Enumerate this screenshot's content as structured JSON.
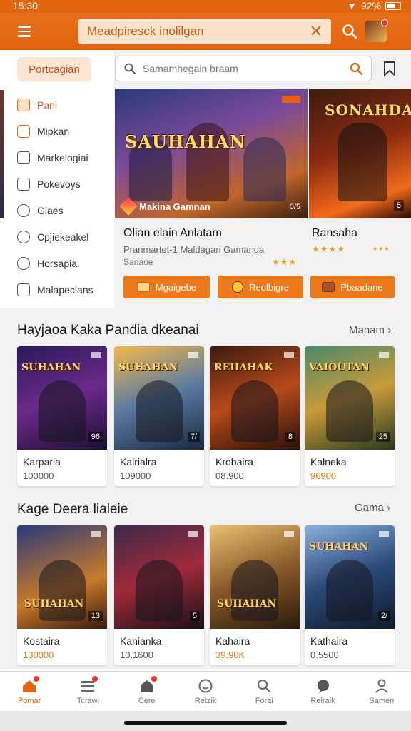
{
  "status": {
    "time": "15:30",
    "battery": "92%"
  },
  "appbar": {
    "search_text": "Meadpiresck inolilgan"
  },
  "sidebar": {
    "title": "Portcagian",
    "items": [
      {
        "label": "Pani",
        "icon": "gift-icon"
      },
      {
        "label": "Mipkan",
        "icon": "flag-icon"
      },
      {
        "label": "Markelogiai",
        "icon": "store-icon"
      },
      {
        "label": "Pokevoys",
        "icon": "card-icon"
      },
      {
        "label": "Giaes",
        "icon": "tag-icon"
      },
      {
        "label": "Cpjiekeakel",
        "icon": "shield-icon"
      },
      {
        "label": "Horsapia",
        "icon": "chat-icon"
      },
      {
        "label": "Malapeclans",
        "icon": "grid-icon"
      }
    ]
  },
  "search": {
    "placeholder": "Samamhegain braam"
  },
  "banner": {
    "main_logo": "SAUHAHAN",
    "main_caption": "Makina Gamnan",
    "main_badge": "0/5",
    "side_logo": "SONAHDAN",
    "side_badge": "5"
  },
  "featured": {
    "title": "Olian elain Anlatam",
    "subtitle": "Pranmartet-1 Maldagari Gamanda",
    "tag": "Sanaoe",
    "side_title": "Ransaha",
    "buttons": [
      {
        "label": "Mgaigebe"
      },
      {
        "label": "Reolbigre"
      },
      {
        "label": "Pbaadane"
      }
    ]
  },
  "sections": [
    {
      "title": "Hayjaoa Kaka Pandia dkeanai",
      "more": "Manam",
      "cards": [
        {
          "name": "Karparia",
          "price": "100000",
          "badge": "96",
          "logo": "SUHAHAN"
        },
        {
          "name": "Kalrialra",
          "price": "109000",
          "badge": "7/",
          "logo": "SUHAHAN"
        },
        {
          "name": "Krobaira",
          "price": "08.900",
          "badge": "8",
          "logo": "REIIAHAK"
        },
        {
          "name": "Kalneka",
          "price": "96900",
          "badge": "25",
          "logo": "VAIOUTAN"
        }
      ]
    },
    {
      "title": "Kage Deera lialeie",
      "more": "Gama",
      "cards": [
        {
          "name": "Kostaira",
          "price": "130000",
          "badge": "13",
          "logo": "SUHAHAN"
        },
        {
          "name": "Kanianka",
          "price": "10.1600",
          "badge": "5",
          "logo": ""
        },
        {
          "name": "Kahaira",
          "price": "39.90K",
          "badge": "",
          "logo": "SUHAHAN"
        },
        {
          "name": "Kathaira",
          "price": "0.5500",
          "badge": "2/",
          "logo": "SUHAHAN"
        }
      ]
    }
  ],
  "bottom_nav": [
    {
      "label": "Pomar",
      "icon": "home-icon"
    },
    {
      "label": "Tcrawi",
      "icon": "list-icon"
    },
    {
      "label": "Cere",
      "icon": "store-icon"
    },
    {
      "label": "Retzik",
      "icon": "face-icon"
    },
    {
      "label": "Forai",
      "icon": "search-icon"
    },
    {
      "label": "Relraik",
      "icon": "chat-icon"
    },
    {
      "label": "Samen",
      "icon": "user-icon"
    }
  ],
  "colors": {
    "accent": "#e2660f",
    "accent_light": "#fde6d4",
    "price_orange": "#e0781a"
  }
}
